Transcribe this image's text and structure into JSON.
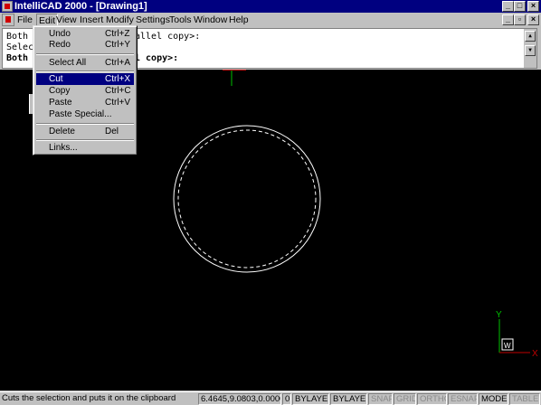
{
  "window": {
    "title": "IntelliCAD 2000 - [Drawing1]",
    "buttons": {
      "minimize": "_",
      "maximize": "□",
      "close": "×"
    }
  },
  "menubar": {
    "items": [
      "File",
      "Edit",
      "View",
      "Insert",
      "Modify",
      "Settings",
      "Tools",
      "Window",
      "Help"
    ],
    "mdi_buttons": {
      "minimize": "_",
      "restore": "▫",
      "close": "×"
    }
  },
  "command_line": {
    "lines": [
      "Both",
      "Selec",
      "Both s"
    ],
    "lines_right": [
      "allel copy>:",
      "",
      "l copy>:"
    ]
  },
  "edit_menu": {
    "items": [
      {
        "label": "Undo",
        "shortcut": "Ctrl+Z"
      },
      {
        "label": "Redo",
        "shortcut": "Ctrl+Y"
      },
      {
        "label": "Select All",
        "shortcut": "Ctrl+A"
      },
      {
        "label": "Cut",
        "shortcut": "Ctrl+X",
        "highlighted": true
      },
      {
        "label": "Copy",
        "shortcut": "Ctrl+C"
      },
      {
        "label": "Paste",
        "shortcut": "Ctrl+V"
      },
      {
        "label": "Paste Special...",
        "shortcut": ""
      },
      {
        "label": "Delete",
        "shortcut": "Del"
      },
      {
        "label": "Links...",
        "shortcut": ""
      }
    ],
    "highlight_color": "#000080"
  },
  "ucs": {
    "y_label": "Y",
    "x_label": "X",
    "w_label": "W"
  },
  "statusbar": {
    "message": "Cuts the selection and puts it on the clipboard",
    "coords": "6.4645,9.0803,0.0000",
    "layer_count": "0",
    "color": "BYLAYER",
    "linetype": "BYLAYER",
    "snap": "SNAP",
    "grid": "GRID",
    "ortho": "ORTHO",
    "esnap": "ESNAP",
    "model": "MODEL",
    "tablet": "TABLET"
  },
  "colors": {
    "titlebar": "#000080",
    "canvas": "#000000",
    "chrome": "#c0c0c0",
    "ucs_y": "#00c000",
    "ucs_x": "#c00000"
  }
}
